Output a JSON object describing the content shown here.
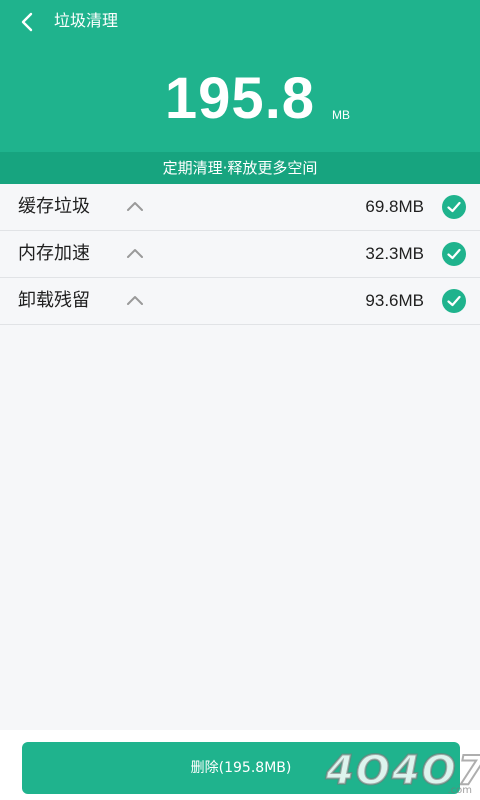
{
  "header": {
    "title": "垃圾清理",
    "total_size": "195.8",
    "total_unit": "MB",
    "background_color": "#1fb38d"
  },
  "banner": {
    "text": "定期清理·释放更多空间",
    "background_color": "#17a47f"
  },
  "items": [
    {
      "label": "缓存垃圾",
      "size": "69.8MB",
      "checked": true
    },
    {
      "label": "内存加速",
      "size": "32.3MB",
      "checked": true
    },
    {
      "label": "卸载残留",
      "size": "93.6MB",
      "checked": true
    }
  ],
  "footer": {
    "delete_label": "删除(195.8MB)"
  },
  "watermark": {
    "text": "4O4O7",
    "small": ".com"
  },
  "icons": {
    "back": "back-arrow-icon",
    "expand": "chevron-up-icon",
    "check": "checkmark-icon"
  }
}
